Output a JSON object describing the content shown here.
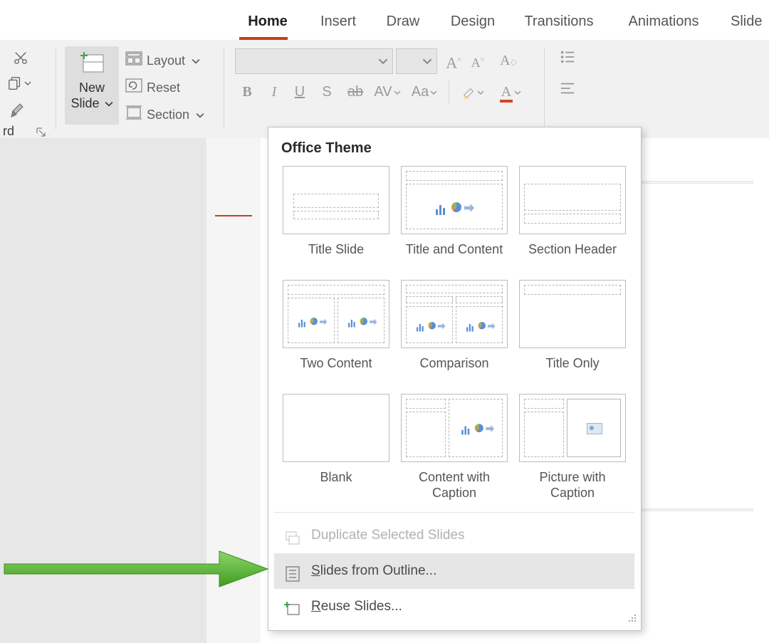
{
  "tabs": {
    "home": "Home",
    "insert": "Insert",
    "draw": "Draw",
    "design": "Design",
    "transitions": "Transitions",
    "animations": "Animations",
    "slideshow": "Slide"
  },
  "clipboard_group": {
    "footer_partial": "rd"
  },
  "slides_group": {
    "new_slide_line1": "New",
    "new_slide_line2": "Slide",
    "layout": "Layout",
    "reset": "Reset",
    "section": "Section"
  },
  "dropdown": {
    "header": "Office Theme",
    "layouts": [
      "Title Slide",
      "Title and Content",
      "Section Header",
      "Two Content",
      "Comparison",
      "Title Only",
      "Blank",
      "Content with Caption",
      "Picture with Caption"
    ],
    "menu": {
      "duplicate": "Duplicate Selected Slides",
      "from_outline": "Slides from Outline...",
      "reuse": "Reuse Slides..."
    }
  },
  "arrow_color": "#4caf2e"
}
